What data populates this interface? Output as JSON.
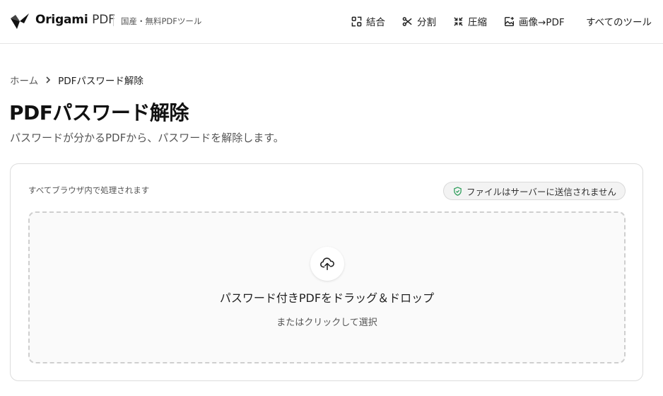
{
  "header": {
    "brand_main": "Origami",
    "brand_sub": "PDF",
    "tagline": "国産・無料PDFツール",
    "nav": [
      {
        "label": "結合",
        "icon": "merge-icon"
      },
      {
        "label": "分割",
        "icon": "scissors-icon"
      },
      {
        "label": "圧縮",
        "icon": "compress-icon"
      },
      {
        "label": "画像→PDF",
        "icon": "image-plus-icon"
      },
      {
        "label": "すべてのツール"
      }
    ]
  },
  "breadcrumb": {
    "home": "ホーム",
    "current": "PDFパスワード解除"
  },
  "page": {
    "title": "PDFパスワード解除",
    "subtitle": "パスワードが分かるPDFから、パスワードを解除します。"
  },
  "card": {
    "note": "すべてブラウザ内で処理されます",
    "badge": "ファイルはサーバーに送信されません",
    "badge_color": "#2e9e5b"
  },
  "dropzone": {
    "title": "パスワード付きPDFをドラッグ＆ドロップ",
    "subtitle": "またはクリックして選択",
    "icon": "cloud-upload-icon"
  }
}
